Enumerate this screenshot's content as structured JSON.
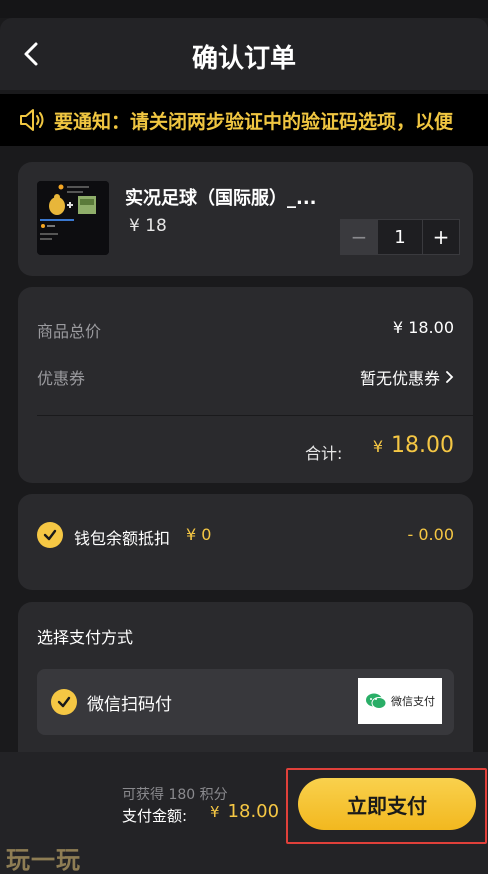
{
  "header": {
    "title": "确认订单",
    "back_icon": "chevron-left-icon"
  },
  "notice": {
    "icon": "speaker-icon",
    "text": "要通知：请关闭两步验证中的验证码选项，以便"
  },
  "product": {
    "title": "实况足球（国际服）_...",
    "price": "¥ 18",
    "quantity": "1",
    "minus": "−",
    "plus": "+"
  },
  "summary": {
    "subtotal_label": "商品总价",
    "subtotal_value": "¥ 18.00",
    "coupon_label": "优惠券",
    "coupon_value": "暂无优惠券",
    "total_label": "合计:",
    "total_currency": "¥",
    "total_value": "18.00"
  },
  "wallet": {
    "label": "钱包余额抵扣",
    "amount": "¥ 0",
    "deduct": "- 0.00"
  },
  "payment": {
    "section_title": "选择支付方式",
    "method_label": "微信扫码付",
    "badge_text": "微信支付"
  },
  "footer": {
    "points": "可获得 180 积分",
    "pay_label": "支付金额:",
    "pay_currency": "¥",
    "pay_value": "18.00",
    "pay_button": "立即支付"
  },
  "watermark": "玩一玩",
  "colors": {
    "accent": "#f5c744",
    "notice_text": "#f0c641",
    "highlight": "#e0403a",
    "background": "#1a1a1c",
    "card": "#2a2a2d"
  }
}
